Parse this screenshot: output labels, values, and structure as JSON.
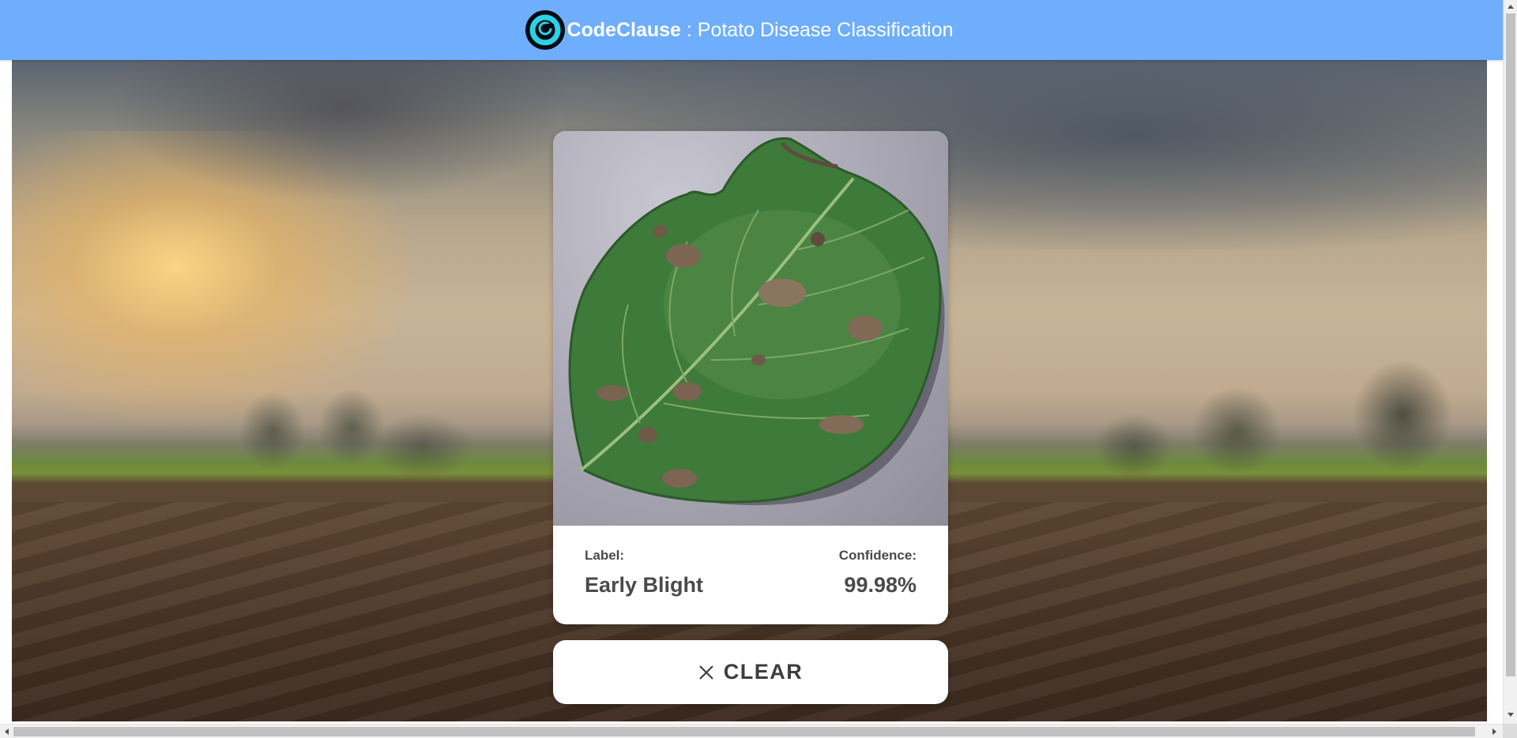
{
  "header": {
    "brand": "CodeClause",
    "subtitle": " : Potato Disease Classification",
    "logo_icon": "codeclause-logo-icon",
    "background_color": "#6eaefd"
  },
  "result": {
    "label_caption": "Label:",
    "label_value": "Early Blight",
    "confidence_caption": "Confidence:",
    "confidence_value": "99.98%"
  },
  "actions": {
    "clear_label": "CLEAR",
    "clear_icon": "close-icon"
  },
  "colors": {
    "card_background": "#ffffff",
    "text": "#4a4a4a"
  }
}
